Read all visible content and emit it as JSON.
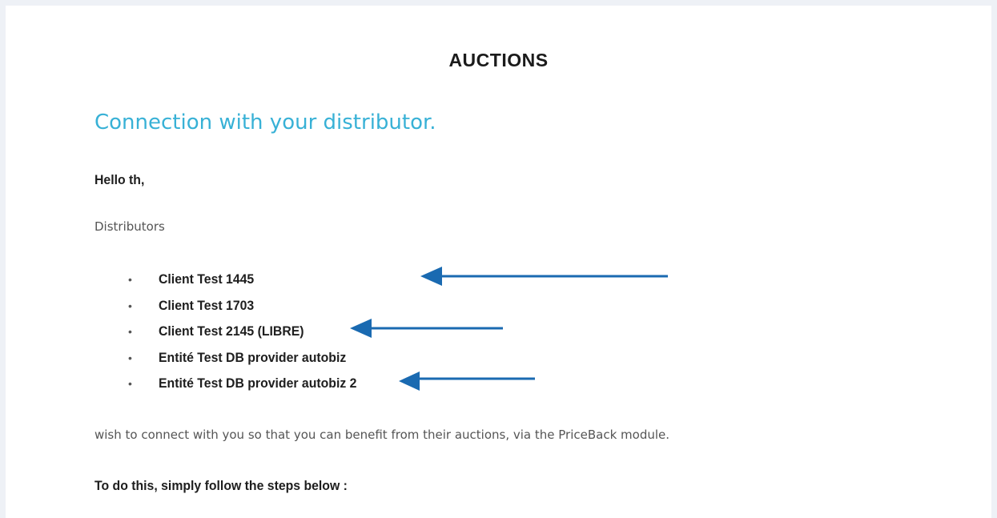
{
  "header": {
    "title": "AUCTIONS"
  },
  "email": {
    "heading": "Connection with your distributor.",
    "greeting": "Hello th,",
    "distributors_label": "Distributors",
    "distributors": [
      "Client Test 1445",
      "Client Test 1703",
      "Client Test 2145 (LIBRE)",
      "Entité Test DB provider autobiz",
      "Entité Test DB provider autobiz 2"
    ],
    "wish_text": "wish to connect with you so that you can benefit from their auctions, via the PriceBack module.",
    "steps_intro": "To do this, simply follow the steps below :"
  },
  "colors": {
    "heading": "#38b1d6",
    "arrow": "#1a6ab1",
    "page_background": "#eef1f6"
  },
  "bullet_glyph": "•"
}
